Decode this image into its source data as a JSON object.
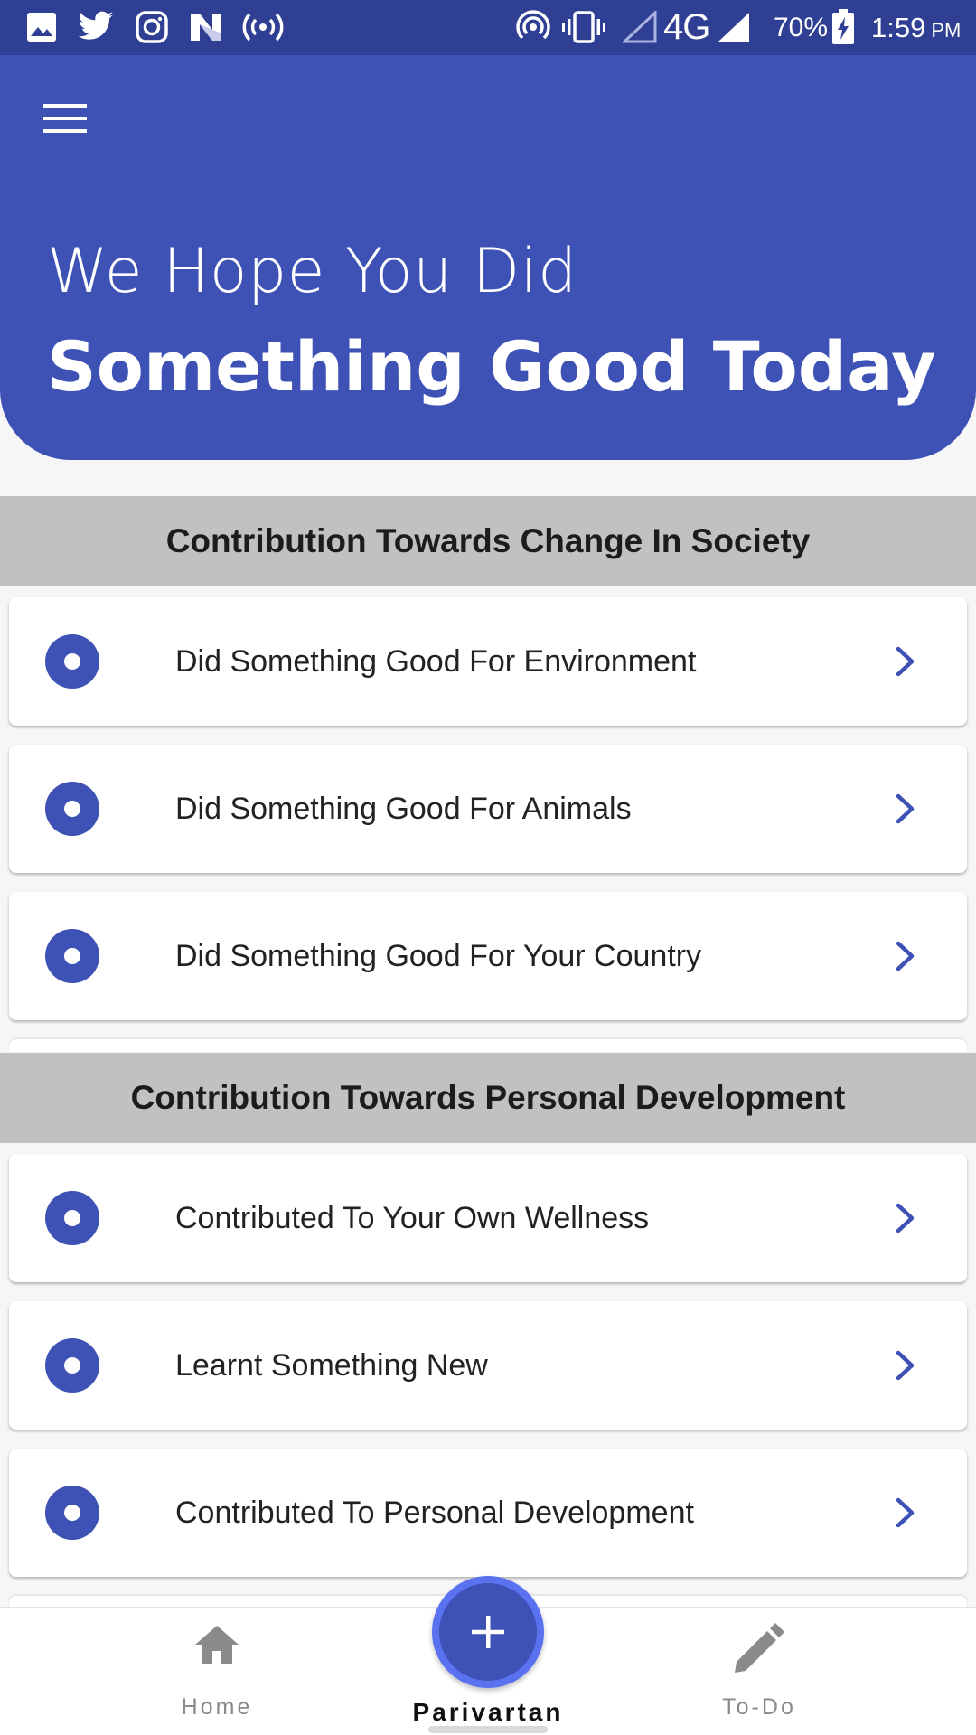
{
  "status_bar": {
    "battery": "70%",
    "network": "4G",
    "time": "1:59",
    "ampm": "PM",
    "left_icons": [
      "gallery-icon",
      "twitter-icon",
      "instagram-icon",
      "n-app-icon",
      "broadcast-icon"
    ],
    "right_icons": [
      "hotspot-icon",
      "vibrate-icon",
      "signal-empty-icon",
      "signal-icon",
      "battery-charging-icon"
    ]
  },
  "app_bar": {
    "menu_icon": "hamburger-menu-icon"
  },
  "hero": {
    "line1": "We Hope You Did",
    "line2": "Something Good Today"
  },
  "sections": [
    {
      "title": "Contribution Towards Change In Society",
      "items": [
        "Did Something Good For Environment",
        "Did Something Good For Animals",
        "Did Something Good For Your Country"
      ]
    },
    {
      "title": "Contribution Towards Personal Development",
      "items": [
        "Contributed To Your Own Wellness",
        "Learnt Something New",
        "Contributed To Personal Development"
      ]
    }
  ],
  "bottom_nav": {
    "home": "Home",
    "center": "Parivartan",
    "todo": "To-Do"
  },
  "colors": {
    "primary": "#3e51b5",
    "status_bar": "#2f3f93",
    "section_header": "#c1c1c1",
    "fab_ring": "#5a72f0"
  }
}
